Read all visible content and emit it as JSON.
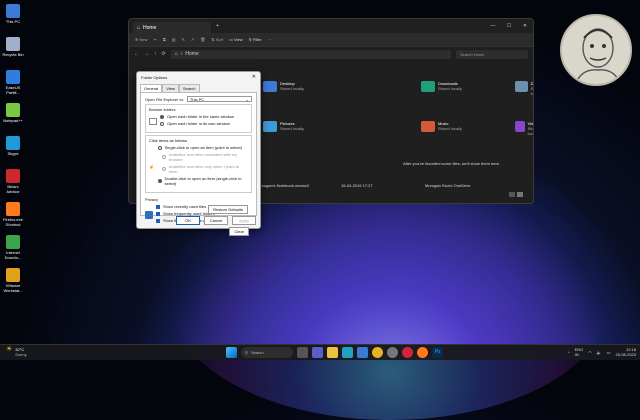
{
  "desktop": {
    "icons": [
      {
        "label": "This PC",
        "icon": "monitor-icon",
        "color": "#3d7ad6"
      },
      {
        "label": "Recycle Bin",
        "icon": "recycle-bin-icon",
        "color": "#9fb0c8"
      },
      {
        "label": "EaseUS Partiti...",
        "icon": "easeus-icon",
        "color": "#2f7de1"
      },
      {
        "label": "Notepad++",
        "icon": "notepad-plus-icon",
        "color": "#7ac943"
      },
      {
        "label": "Skype",
        "icon": "skype-icon",
        "color": "#1e9bd7"
      },
      {
        "label": "Belarc Advisor",
        "icon": "belarc-icon",
        "color": "#cc2a2a"
      },
      {
        "label": "Firefox.exe Shortcut",
        "icon": "firefox-icon",
        "color": "#ff7a1a"
      },
      {
        "label": "Internet Downlo...",
        "icon": "internet-download-icon",
        "color": "#3aa54a"
      },
      {
        "label": "VMware Workstat...",
        "icon": "vmware-icon",
        "color": "#e0a21a"
      }
    ]
  },
  "explorer": {
    "tab_title": "Home",
    "new_tab": "+",
    "commands": [
      "New",
      "Sort",
      "View",
      "Filter"
    ],
    "address": "Home",
    "search_placeholder": "Search Home",
    "quick_access": [
      {
        "name": "Desktop",
        "sub": "Stored locally",
        "color": "#3d7ad6"
      },
      {
        "name": "Downloads",
        "sub": "Stored locally",
        "color": "#1fa07a"
      },
      {
        "name": "Documents",
        "sub": "Stored locally",
        "color": "#6f8fb0"
      },
      {
        "name": "Pictures",
        "sub": "Stored locally",
        "color": "#3d9ad6"
      },
      {
        "name": "Music",
        "sub": "Stored locally",
        "color": "#d25a3a"
      },
      {
        "name": "Videos",
        "sub": "Stored locally",
        "color": "#8a45c9"
      }
    ],
    "favorites_empty": "After you've favorited some files, we'll show them here.",
    "recent_file": "Murugan's Notebook.onetoc2",
    "recent_date": "15-04-2019 17:27",
    "recent_location": "Murugan Siva's OneDrive"
  },
  "dialog": {
    "title": "Folder Options",
    "tabs": [
      "General",
      "View",
      "Search"
    ],
    "open_label": "Open File Explorer to:",
    "open_value": "This PC",
    "browse_title": "Browse folders",
    "browse_opts": [
      "Open each folder in the same window",
      "Open each folder in its own window"
    ],
    "click_title": "Click items as follows",
    "click_opts": [
      "Single-click to open an item (point to select)",
      "Underline icon titles consistent with my browser",
      "Underline icon titles only when I point at them",
      "Double-click to open an item (single-click to select)"
    ],
    "privacy_title": "Privacy",
    "privacy_opts": [
      "Show recently used files",
      "Show frequently used folders",
      "Show files from Office.com"
    ],
    "clear_label": "Clear File Explorer history",
    "clear_btn": "Clear",
    "restore_btn": "Restore Defaults",
    "ok": "OK",
    "cancel": "Cancel",
    "apply": "Apply"
  },
  "taskbar": {
    "temp": "32°C",
    "weather": "Sunny",
    "search": "Search",
    "lang1": "ENG",
    "lang2": "IN",
    "time": "12:18",
    "date": "25-08-2023"
  }
}
